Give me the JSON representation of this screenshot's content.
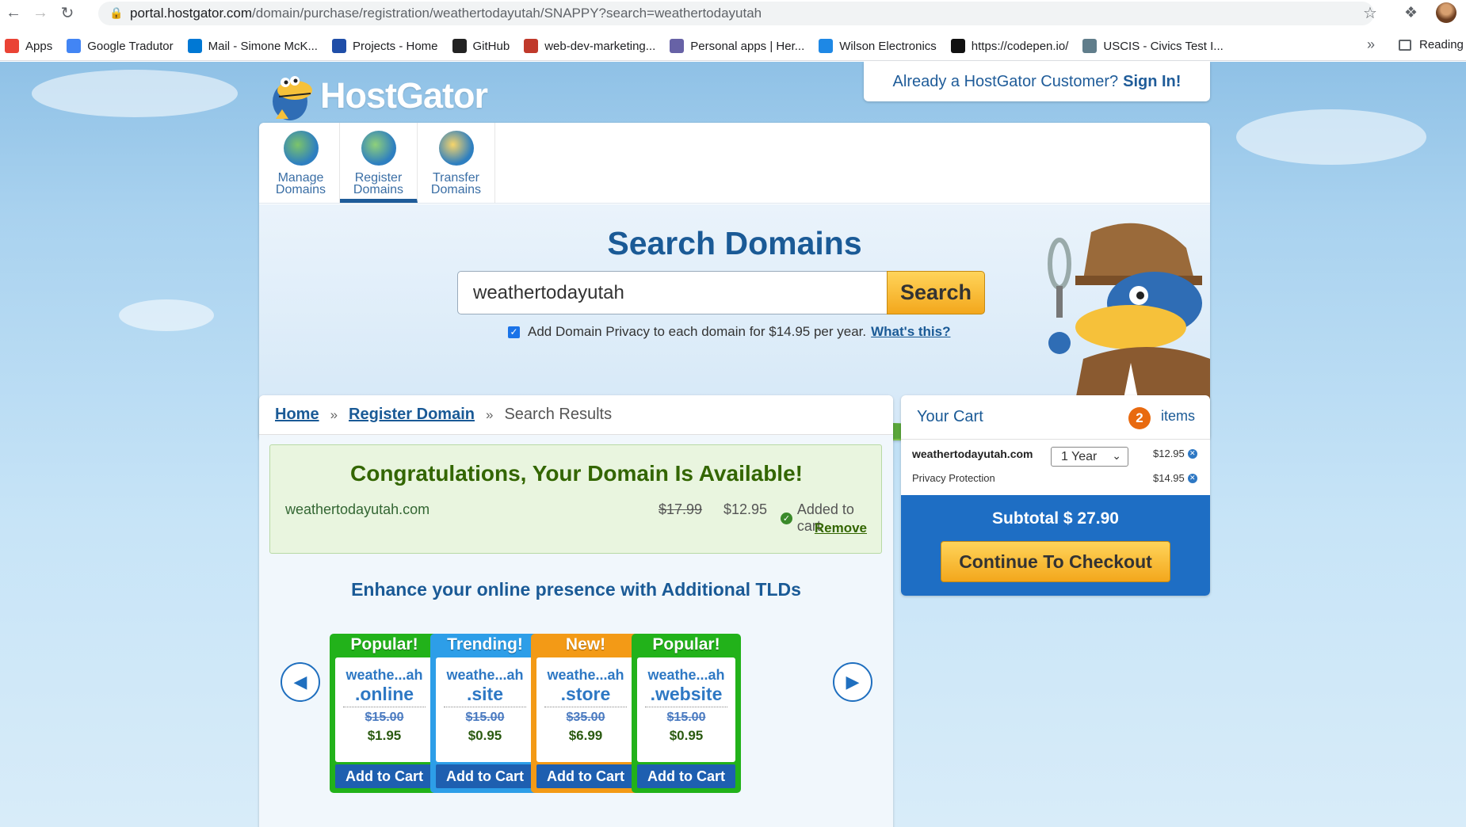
{
  "browser": {
    "url_host": "portal.hostgator.com",
    "url_path": "/domain/purchase/registration/weathertodayutah/SNAPPY?search=weathertodayutah",
    "bookmarks": [
      {
        "label": "Apps",
        "color": "#ea4335"
      },
      {
        "label": "Google Tradutor",
        "color": "#4285f4"
      },
      {
        "label": "Mail - Simone McK...",
        "color": "#0078d4"
      },
      {
        "label": "Projects - Home",
        "color": "#1f4ea8"
      },
      {
        "label": "GitHub",
        "color": "#222222"
      },
      {
        "label": "web-dev-marketing...",
        "color": "#c0392b"
      },
      {
        "label": "Personal apps | Her...",
        "color": "#6762a6"
      },
      {
        "label": "Wilson Electronics",
        "color": "#1e88e5"
      },
      {
        "label": "https://codepen.io/",
        "color": "#111111"
      },
      {
        "label": "USCIS - Civics Test I...",
        "color": "#607d8b"
      }
    ],
    "reading_list": "Reading"
  },
  "header": {
    "logo_text": "HostGator",
    "signin_prefix": "Already a HostGator Customer?",
    "signin_link": "Sign In!"
  },
  "tabs": [
    {
      "line1": "Manage",
      "line2": "Domains"
    },
    {
      "line1": "Register",
      "line2": "Domains"
    },
    {
      "line1": "Transfer",
      "line2": "Domains"
    }
  ],
  "search": {
    "title": "Search Domains",
    "value": "weathertodayutah",
    "button": "Search",
    "privacy_text": "Add Domain Privacy to each domain for $14.95 per year.",
    "privacy_link": "What's this?"
  },
  "breadcrumb": {
    "home": "Home",
    "register": "Register Domain",
    "current": "Search Results",
    "sep": "»"
  },
  "availability": {
    "title": "Congratulations, Your Domain Is Available!",
    "domain": "weathertodayutah.com",
    "old_price": "$17.99",
    "new_price": "$12.95",
    "status": "Added to cart",
    "remove": "Remove"
  },
  "enhance_title": "Enhance your online presence with Additional TLDs",
  "tlds": [
    {
      "badge": "Popular!",
      "name": "weathe...ah",
      "ext": ".online",
      "old": "$15.00",
      "new": "$1.95",
      "cart": "Add to Cart",
      "color": "#22b21a"
    },
    {
      "badge": "Trending!",
      "name": "weathe...ah",
      "ext": ".site",
      "old": "$15.00",
      "new": "$0.95",
      "cart": "Add to Cart",
      "color": "#2d9ee8"
    },
    {
      "badge": "New!",
      "name": "weathe...ah",
      "ext": ".store",
      "old": "$35.00",
      "new": "$6.99",
      "cart": "Add to Cart",
      "color": "#f39a16"
    },
    {
      "badge": "Popular!",
      "name": "weathe...ah",
      "ext": ".website",
      "old": "$15.00",
      "new": "$0.95",
      "cart": "Add to Cart",
      "color": "#22b21a"
    }
  ],
  "cart": {
    "title": "Your Cart",
    "count": "2",
    "items_label": "items",
    "domain": "weathertodayutah.com",
    "term": "1 Year",
    "domain_price": "$12.95",
    "privacy_label": "Privacy Protection",
    "privacy_price": "$14.95",
    "subtotal": "Subtotal $ 27.90",
    "checkout": "Continue To Checkout"
  }
}
